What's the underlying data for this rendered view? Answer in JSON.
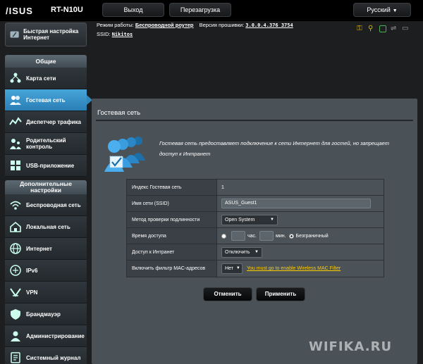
{
  "topbar": {
    "logo": "/ISUS",
    "model": "RT-N10U",
    "logout_label": "Выход",
    "reboot_label": "Перезагрузка",
    "language_label": "Русский"
  },
  "status": {
    "mode_label": "Режим работы:",
    "mode_value": "Беспроводной роутер",
    "firmware_label": "Версия прошивки:",
    "firmware_value": "3.0.0.4.376_3754",
    "ssid_label": "SSID:",
    "ssid_value": "Nikitos"
  },
  "sidebar": {
    "quick_setup_label": "Быстрая настройка Интернет",
    "general_header": "Общие",
    "general_items": [
      {
        "label": "Карта сети",
        "icon": "network-map-icon"
      },
      {
        "label": "Гостевая сеть",
        "icon": "guest-network-icon",
        "active": true
      },
      {
        "label": "Диспетчер трафика",
        "icon": "traffic-manager-icon"
      },
      {
        "label": "Родительский контроль",
        "icon": "parental-control-icon"
      },
      {
        "label": "USB-приложение",
        "icon": "usb-app-icon"
      }
    ],
    "advanced_header": "Дополнительные настройки",
    "advanced_items": [
      {
        "label": "Беспроводная сеть",
        "icon": "wireless-icon"
      },
      {
        "label": "Локальная сеть",
        "icon": "lan-icon"
      },
      {
        "label": "Интернет",
        "icon": "internet-icon"
      },
      {
        "label": "IPv6",
        "icon": "ipv6-icon"
      },
      {
        "label": "VPN",
        "icon": "vpn-icon"
      },
      {
        "label": "Брандмауэр",
        "icon": "firewall-icon"
      },
      {
        "label": "Администрирование",
        "icon": "administration-icon"
      },
      {
        "label": "Системный журнал",
        "icon": "system-log-icon"
      }
    ]
  },
  "main": {
    "title": "Гостевая сеть",
    "intro": "Гостевая сеть предоставляет подключение к сети Интернет для гостей, но запрещает доступ к Интранет",
    "form": {
      "index_label": "Индекс Гостевая сеть",
      "index_value": "1",
      "ssid_label": "Имя сети (SSID)",
      "ssid_value": "ASUS_Guest1",
      "auth_label": "Метод проверки подлинности",
      "auth_value": "Open System",
      "access_time_label": "Время доступа",
      "hours_unit": "час.",
      "minutes_unit": "мин.",
      "unlimited_label": "Безграничный",
      "intranet_label": "Доступ к Интранет",
      "intranet_value": "Отключить",
      "mac_filter_label": "Включить фильтр MAC-адресов",
      "mac_filter_value": "Нет",
      "mac_filter_link": "You must go to enable Wireless MAC Filter"
    },
    "cancel_label": "Отменить",
    "apply_label": "Применить"
  },
  "watermark": "WIFIKA.RU",
  "colors": {
    "accent_active": "#2a7eb5",
    "link_yellow": "#ffcc00",
    "panel_bg": "#4a5258"
  }
}
